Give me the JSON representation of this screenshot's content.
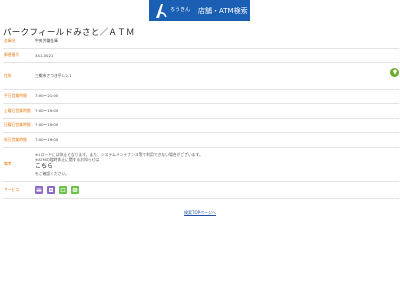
{
  "header": {
    "logo_text": "ろうきん",
    "title": "店舗・ATM検索",
    "brand_color": "#1a5fb4"
  },
  "page": {
    "title": "パークフィールドみさと／ＡＴＭ"
  },
  "rows": [
    {
      "label": "金庫名",
      "value": "中央労働金庫"
    },
    {
      "label": "郵便番号",
      "value": "341-0021"
    },
    {
      "label": "住所",
      "value": "三郷市さつき平1-2-1"
    },
    {
      "label": "平日営業時間",
      "value": "7:00～21:00"
    },
    {
      "label": "土曜日営業時間",
      "value": "7:00～19:00"
    },
    {
      "label": "日曜日営業時間",
      "value": "7:00～19:00"
    },
    {
      "label": "祝日営業時間",
      "value": "7:00～19:00"
    }
  ],
  "notice": {
    "label": "備考",
    "line1": "※1ロードには休止となります。また、システムメンテナンス等で利用できない場合がございます。",
    "line2": "※ATMの臨時休止に関するお知らせは",
    "link": "こちら",
    "line3": "をご確認ください。"
  },
  "services": {
    "label": "サービス",
    "icons": [
      "atm-card-icon",
      "passbook-icon",
      "wheelchair-icon",
      "parking-icon"
    ]
  },
  "footer": {
    "link": "検索TOPページへ"
  },
  "colors": {
    "label_orange": "#e87a14",
    "map_green": "#6aac2a",
    "link_blue": "#1d4fa8"
  }
}
